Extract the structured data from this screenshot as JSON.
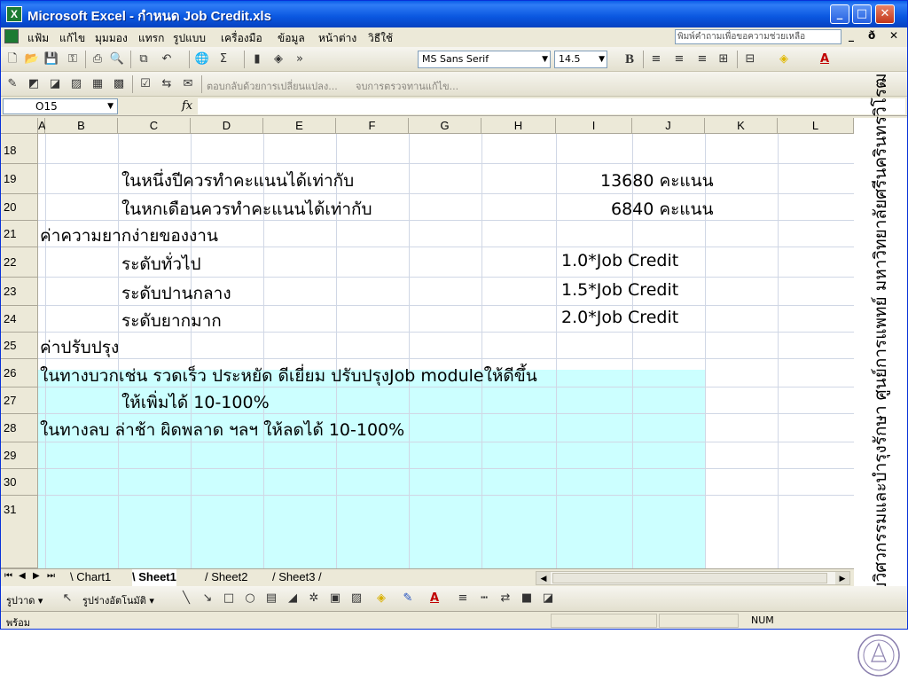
{
  "window": {
    "title": "Microsoft Excel - กำหนด Job Credit.xls",
    "controls": [
      "_",
      "□",
      "✕"
    ]
  },
  "menu": {
    "items": [
      "แฟ้ม",
      "แก้ไข",
      "มุมมอง",
      "แทรก",
      "รูปแบบ",
      "เครื่องมือ",
      "ข้อมูล",
      "หน้าต่าง",
      "วิธีใช้"
    ],
    "help_placeholder": "พิมพ์คำถามเพื่อขอความช่วยเหลือ",
    "win_controls": [
      "_",
      "ð",
      "✕"
    ]
  },
  "toolbar": {
    "font_name": "MS Sans Serif",
    "font_size": "14.5",
    "bold": "B",
    "underline_letter": "A",
    "reply_text": "ตอบกลับด้วยการเปลี่ยนแปลง...",
    "end_review_text": "จบการตรวจทานแก้ไข..."
  },
  "formula_bar": {
    "name_box": "O15",
    "fx": "fx",
    "content": ""
  },
  "grid": {
    "columns": [
      "A",
      "B",
      "C",
      "D",
      "E",
      "F",
      "G",
      "H",
      "I",
      "J",
      "K",
      "L"
    ],
    "rows": [
      "18",
      "19",
      "20",
      "21",
      "22",
      "23",
      "24",
      "25",
      "26",
      "27",
      "28",
      "29",
      "30",
      "31"
    ],
    "cells": {
      "r19_c": "ในหนึ่งปีควรทำคะแนนได้เท่ากับ",
      "r19_i": "13680 คะแนน",
      "r20_c": "ในหกเดือนควรทำคะแนนได้เท่ากับ",
      "r20_i": "6840 คะแนน",
      "r21_a": "ค่าความยากง่ายของงาน",
      "r22_c": "ระดับทั่วไป",
      "r22_i": "1.0*Job Credit",
      "r23_c": "ระดับปานกลาง",
      "r23_i": "1.5*Job Credit",
      "r24_c": "ระดับยากมาก",
      "r24_i": "2.0*Job Credit",
      "r25_a": "ค่าปรับปรุง",
      "r26_a": " ในทางบวกเช่น รวดเร็ว ประหยัด ดีเยี่ยม ปรับปรุงJob moduleให้ดีขึ้น",
      "r27_c": "ให้เพิ่มได้ 10-100%",
      "r28_a": " ในทางลบ ล่าช้า ผิดพลาด ฯลฯ ให้ลดได้ 10-100%"
    },
    "highlight_colors": {
      "cyan": "#ccffff",
      "yellow": "#ffff99"
    }
  },
  "sheet_tabs": {
    "nav": [
      "⏮",
      "◀",
      "▶",
      "⏭"
    ],
    "tabs": [
      "Chart1",
      "Sheet1",
      "Sheet2",
      "Sheet3"
    ],
    "active": "Sheet1"
  },
  "drawing_toolbar": {
    "draw_label": "รูปวาด ▾",
    "autoshapes_label": "รูปร่างอัตโนมัติ ▾"
  },
  "status_bar": {
    "ready": "พร้อม",
    "num": "NUM"
  },
  "side_banner": {
    "text": "ฝ่ายวิศวกรรมและบำรุงรักษา ศูนย์การแพทย์ มหาวิทยาลัยศรีนครินทรวิโรฒ"
  }
}
